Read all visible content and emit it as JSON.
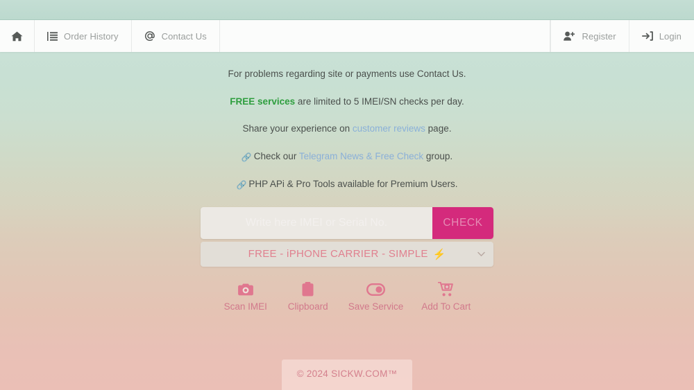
{
  "theme": {
    "accent_pink": "#d42a7c",
    "link_blue": "#8ab0d8",
    "free_green": "#2e9e3e",
    "action_pink": "#e0778f",
    "bolt_orange": "#f08a20",
    "bg_top": "#c4ded4",
    "bg_bottom": "#ebbfb6"
  },
  "navbar": {
    "left_items": [
      {
        "label": "",
        "icon": "home-icon",
        "name": "nav-home"
      },
      {
        "label": "Order History",
        "icon": "list-icon",
        "name": "nav-order-history"
      },
      {
        "label": "Contact Us",
        "icon": "at-icon",
        "name": "nav-contact-us"
      }
    ],
    "right_items": [
      {
        "label": "Register",
        "icon": "user-plus-icon",
        "name": "nav-register"
      },
      {
        "label": "Login",
        "icon": "sign-in-icon",
        "name": "nav-login"
      }
    ]
  },
  "notices": {
    "line1": "For problems regarding site or payments use Contact Us.",
    "line2_strong": "FREE services",
    "line2_rest": " are limited to 5 IMEI/SN checks per day.",
    "line3_pre": "Share your experience on ",
    "line3_link": "customer reviews",
    "line3_post": " page.",
    "line4_icon": "🔗",
    "line4_pre": "Check our ",
    "line4_link": "Telegram News & Free Check",
    "line4_post": " group.",
    "line5_icon": "🔗",
    "line5_text": "PHP APi & Pro Tools available for Premium Users."
  },
  "search": {
    "placeholder": "Write here IMEI or Serial No.",
    "value": "",
    "check_label": "CHECK"
  },
  "service_select": {
    "selected": "FREE - iPHONE CARRIER - SIMPLE",
    "badge": "⚡",
    "caret": "chevron-down-icon"
  },
  "actions": [
    {
      "label": "Scan IMEI",
      "icon": "camera-icon",
      "name": "scan-imei"
    },
    {
      "label": "Clipboard",
      "icon": "clipboard-icon",
      "name": "clipboard"
    },
    {
      "label": "Save Service",
      "icon": "toggle-icon",
      "name": "save-service"
    },
    {
      "label": "Add To Cart",
      "icon": "cart-plus-icon",
      "name": "add-to-cart"
    }
  ],
  "footer": {
    "copyright": "© 2024 SICKW.COM™"
  }
}
